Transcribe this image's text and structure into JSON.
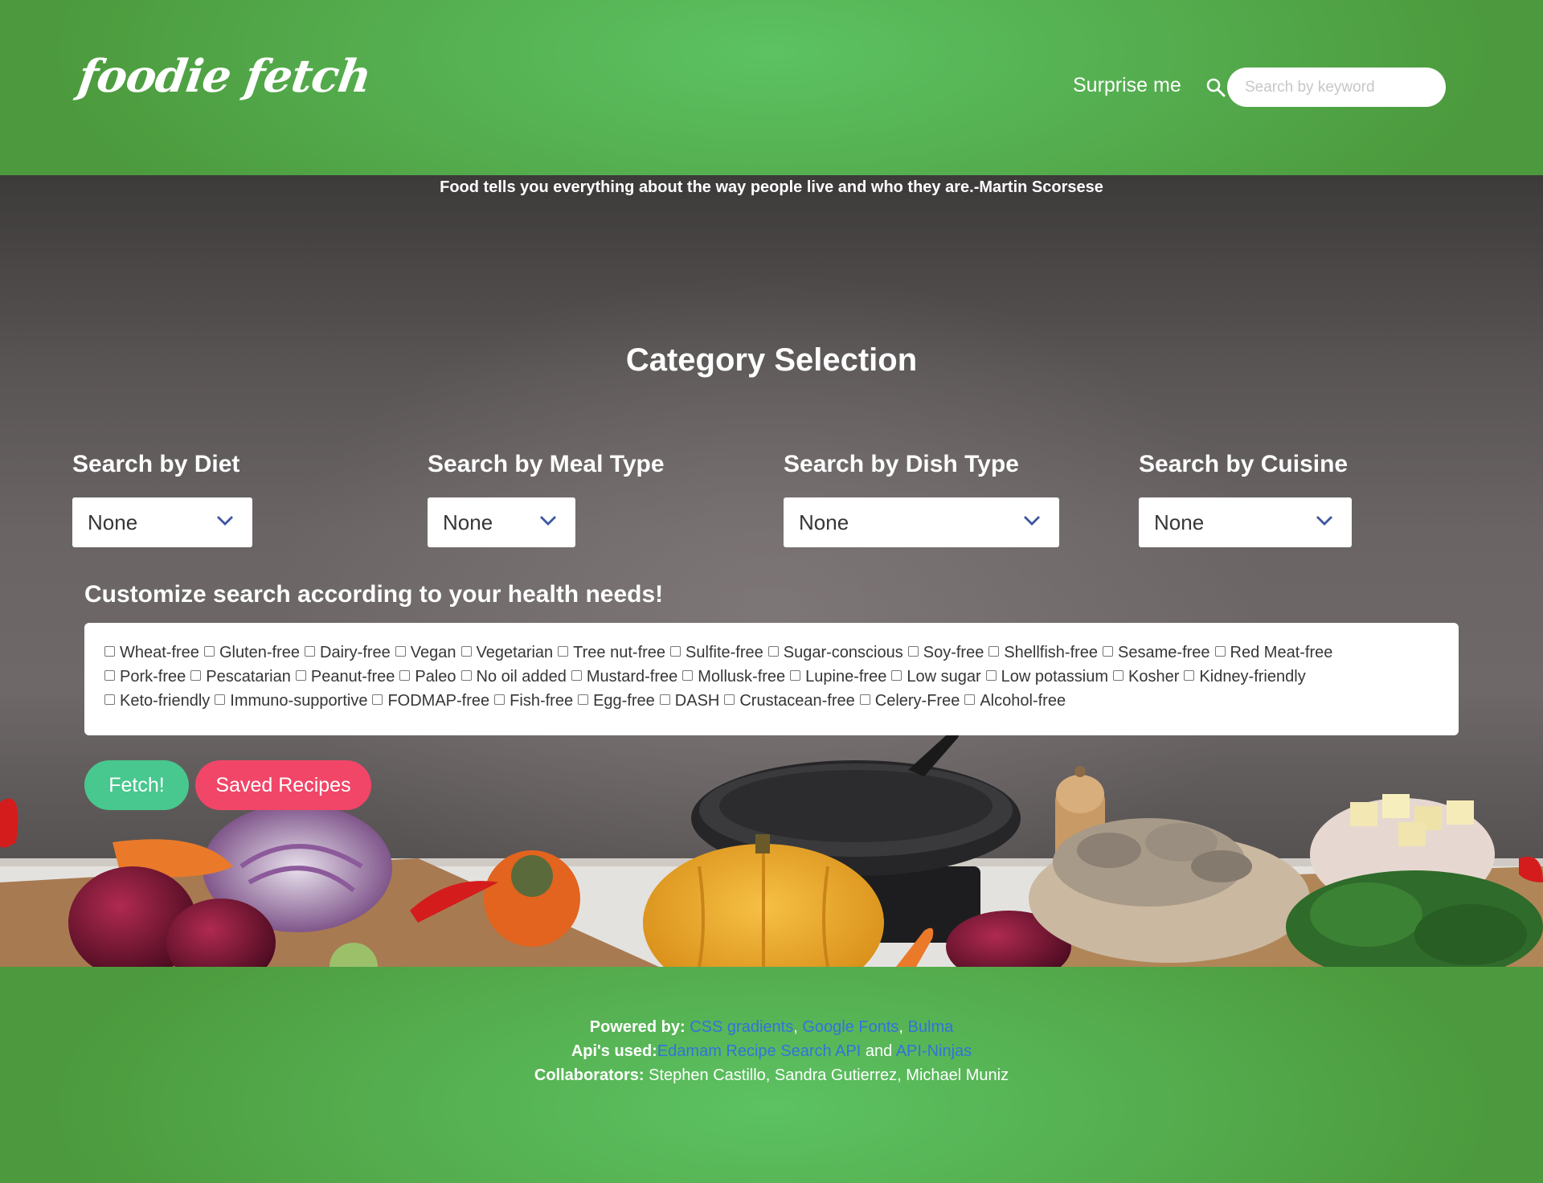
{
  "header": {
    "logo": "foodie fetch",
    "surprise_label": "Surprise me",
    "search_placeholder": "Search by keyword"
  },
  "hero": {
    "quote": "Food tells you everything about the way people live and who they are.-Martin Scorsese",
    "title": "Category Selection",
    "filters": [
      {
        "label": "Search by Diet",
        "value": "None"
      },
      {
        "label": "Search by Meal Type",
        "value": "None"
      },
      {
        "label": "Search by Dish Type",
        "value": "None"
      },
      {
        "label": "Search by Cuisine",
        "value": "None"
      }
    ],
    "health_title": "Customize search according to your health needs!",
    "health_options": [
      "Wheat-free",
      "Gluten-free",
      "Dairy-free",
      "Vegan",
      "Vegetarian",
      "Tree nut-free",
      "Sulfite-free",
      "Sugar-conscious",
      "Soy-free",
      "Shellfish-free",
      "Sesame-free",
      "Red Meat-free",
      "Pork-free",
      "Pescatarian",
      "Peanut-free",
      "Paleo",
      "No oil added",
      "Mustard-free",
      "Mollusk-free",
      "Lupine-free",
      "Low sugar",
      "Low potassium",
      "Kosher",
      "Kidney-friendly",
      "Keto-friendly",
      "Immuno-supportive",
      "FODMAP-free",
      "Fish-free",
      "Egg-free",
      "DASH",
      "Crustacean-free",
      "Celery-Free",
      "Alcohol-free"
    ],
    "fetch_label": "Fetch!",
    "saved_label": "Saved Recipes"
  },
  "footer": {
    "powered_label": "Powered by:",
    "powered_links": [
      "CSS gradients",
      "Google Fonts",
      "Bulma"
    ],
    "sep": ", ",
    "apis_label": "Api's used:",
    "api_link_1": "Edamam Recipe Search API",
    "and": "and",
    "api_link_2": "API-Ninjas",
    "collab_label": "Collaborators:",
    "collab_names": "Stephen Castillo, Sandra Gutierrez, Michael Muniz"
  },
  "colors": {
    "header_green": "#54ad4e",
    "fetch_button": "#48c78e",
    "saved_button": "#f14668",
    "link_blue": "#3273dc"
  }
}
